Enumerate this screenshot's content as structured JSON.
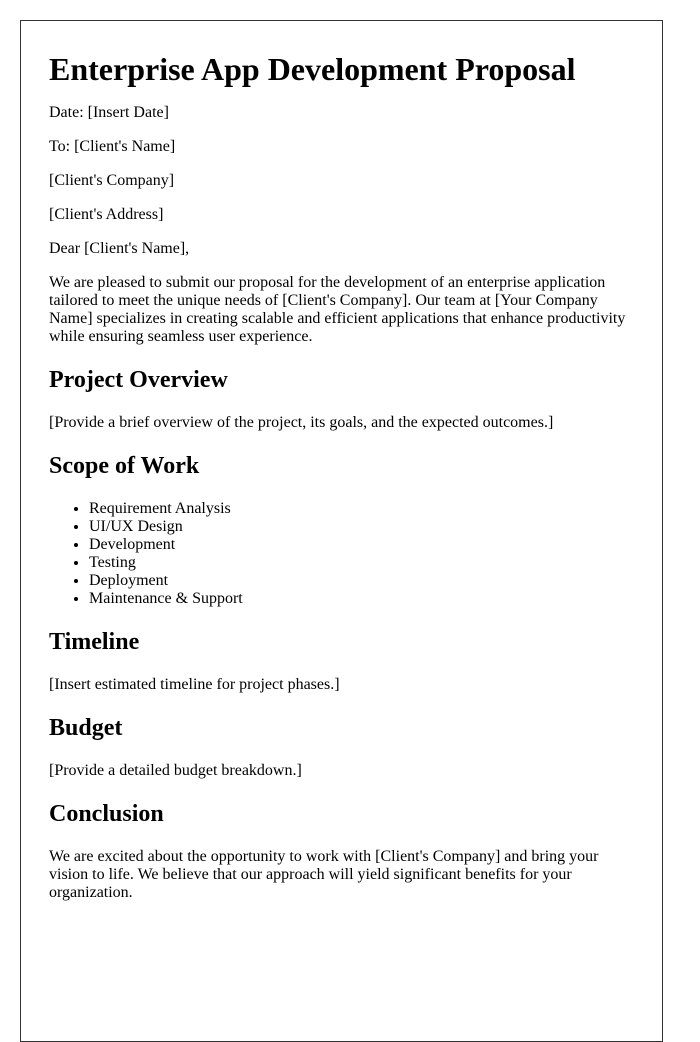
{
  "document": {
    "title": "Enterprise App Development Proposal",
    "date_line": "Date: [Insert Date]",
    "to_line": "To: [Client's Name]",
    "company_line": "[Client's Company]",
    "address_line": "[Client's Address]",
    "salutation": "Dear [Client's Name],",
    "intro": "We are pleased to submit our proposal for the development of an enterprise application tailored to meet the unique needs of [Client's Company]. Our team at [Your Company Name] specializes in creating scalable and efficient applications that enhance productivity while ensuring seamless user experience.",
    "sections": [
      {
        "heading": "Project Overview",
        "body": "[Provide a brief overview of the project, its goals, and the expected outcomes.]"
      },
      {
        "heading": "Scope of Work",
        "items": [
          "Requirement Analysis",
          "UI/UX Design",
          "Development",
          "Testing",
          "Deployment",
          "Maintenance & Support"
        ]
      },
      {
        "heading": "Timeline",
        "body": "[Insert estimated timeline for project phases.]"
      },
      {
        "heading": "Budget",
        "body": "[Provide a detailed budget breakdown.]"
      },
      {
        "heading": "Conclusion",
        "body": "We are excited about the opportunity to work with [Client's Company] and bring your vision to life. We believe that our approach will yield significant benefits for your organization."
      }
    ]
  }
}
